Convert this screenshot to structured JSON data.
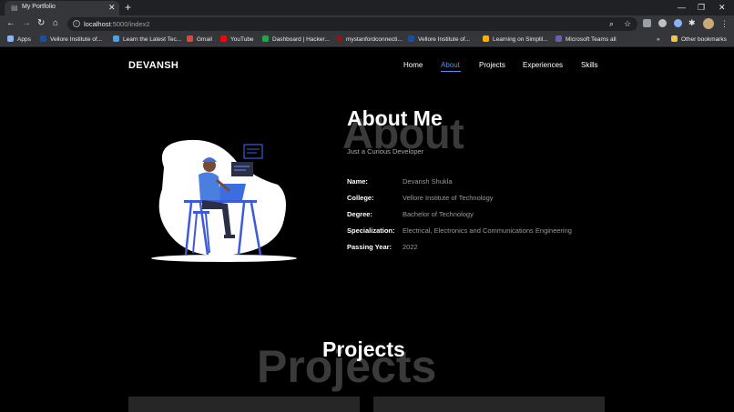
{
  "browser": {
    "tab_title": "My Portfolio",
    "new_tab": "+",
    "url_host": "localhost",
    "url_rest": ":5000/index2",
    "bookmarks": [
      {
        "label": "Apps",
        "color": "#8ab4f8"
      },
      {
        "label": "Vellore Institute of...",
        "color": "#1a4fa0"
      },
      {
        "label": "Learn the Latest Tec...",
        "color": "#4aa3df"
      },
      {
        "label": "Gmail",
        "color": "#ea4335"
      },
      {
        "label": "YouTube",
        "color": "#ff0000"
      },
      {
        "label": "Dashboard | Hacker...",
        "color": "#1ba94c"
      },
      {
        "label": "mystanfordconnecti...",
        "color": "#8c1515"
      },
      {
        "label": "Vellore Institute of...",
        "color": "#1a4fa0"
      },
      {
        "label": "Learning on Simplil...",
        "color": "#f4b400"
      },
      {
        "label": "Microsoft Teams all",
        "color": "#6264a7"
      }
    ],
    "overflow": "»",
    "other_bookmarks": "Other bookmarks"
  },
  "site": {
    "brand": "DEVANSH",
    "nav": [
      "Home",
      "About",
      "Projects",
      "Experiences",
      "Skills"
    ],
    "active_nav": "About",
    "accent": "#5b8def"
  },
  "about": {
    "bg_text": "About",
    "title": "About Me",
    "subtitle": "Just a Curious Developer",
    "rows": [
      {
        "label": "Name:",
        "value": "Devansh Shukla"
      },
      {
        "label": "College:",
        "value": "Vellore Institute of Technology"
      },
      {
        "label": "Degree:",
        "value": "Bachelor of Technology"
      },
      {
        "label": "Specialization:",
        "value": "Electrical, Electronics and Communications Engineering"
      },
      {
        "label": "Passing Year:",
        "value": "2022"
      }
    ]
  },
  "projects": {
    "bg_text": "Projects",
    "title": "Projects"
  }
}
